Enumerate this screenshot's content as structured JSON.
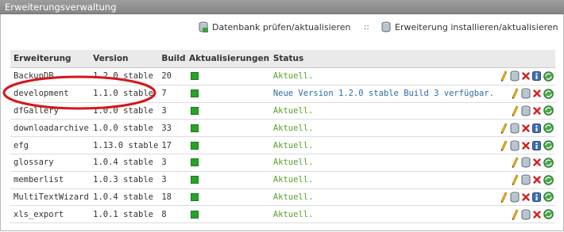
{
  "panel": {
    "title": "Erweiterungsverwaltung"
  },
  "toolbar": {
    "check_db_label": "Datenbank prüfen/aktualisieren",
    "separator": "::",
    "install_label": "Erweiterung installieren/aktualisieren"
  },
  "table": {
    "headers": [
      "Erweiterung",
      "Version",
      "Build",
      "Aktualisierungen",
      "Status"
    ],
    "rows": [
      {
        "name": "BackupDB",
        "version": "1.2.0 stable",
        "build": "20",
        "status": "Aktuell.",
        "status_type": "ok",
        "actions": [
          "edit",
          "database",
          "delete",
          "info",
          "update"
        ]
      },
      {
        "name": "development",
        "version": "1.1.0 stable",
        "build": "7",
        "status": "Neue Version 1.2.0 stable Build 3 verfügbar.",
        "status_type": "new",
        "actions": [
          "edit",
          "database",
          "delete",
          "update"
        ]
      },
      {
        "name": "dfGallery",
        "version": "1.0.0 stable",
        "build": "3",
        "status": "Aktuell.",
        "status_type": "ok",
        "actions": [
          "edit",
          "database",
          "delete",
          "update"
        ]
      },
      {
        "name": "downloadarchive",
        "version": "1.0.0 stable",
        "build": "33",
        "status": "Aktuell.",
        "status_type": "ok",
        "actions": [
          "edit",
          "database",
          "delete",
          "info",
          "update"
        ]
      },
      {
        "name": "efg",
        "version": "1.13.0 stable",
        "build": "17",
        "status": "Aktuell.",
        "status_type": "ok",
        "actions": [
          "edit",
          "database",
          "delete",
          "info",
          "update"
        ]
      },
      {
        "name": "glossary",
        "version": "1.0.4 stable",
        "build": "3",
        "status": "Aktuell.",
        "status_type": "ok",
        "actions": [
          "edit",
          "database",
          "delete",
          "update"
        ]
      },
      {
        "name": "memberlist",
        "version": "1.0.3 stable",
        "build": "3",
        "status": "Aktuell.",
        "status_type": "ok",
        "actions": [
          "edit",
          "database",
          "delete",
          "update"
        ]
      },
      {
        "name": "MultiTextWizard",
        "version": "1.0.4 stable",
        "build": "18",
        "status": "Aktuell.",
        "status_type": "ok",
        "actions": [
          "edit",
          "database",
          "delete",
          "info",
          "update"
        ]
      },
      {
        "name": "xls_export",
        "version": "1.0.1 stable",
        "build": "8",
        "status": "Aktuell.",
        "status_type": "ok",
        "actions": [
          "edit",
          "database",
          "delete",
          "update"
        ]
      }
    ]
  },
  "colors": {
    "ok": "#5aa02c",
    "new": "#2e6aa8",
    "header_bg": "#8f8f8f",
    "highlight_circle": "#d4161c"
  },
  "icons": {
    "edit": "pencil-icon",
    "database": "database-icon",
    "delete": "delete-icon",
    "info": "info-icon",
    "update": "update-icon"
  }
}
